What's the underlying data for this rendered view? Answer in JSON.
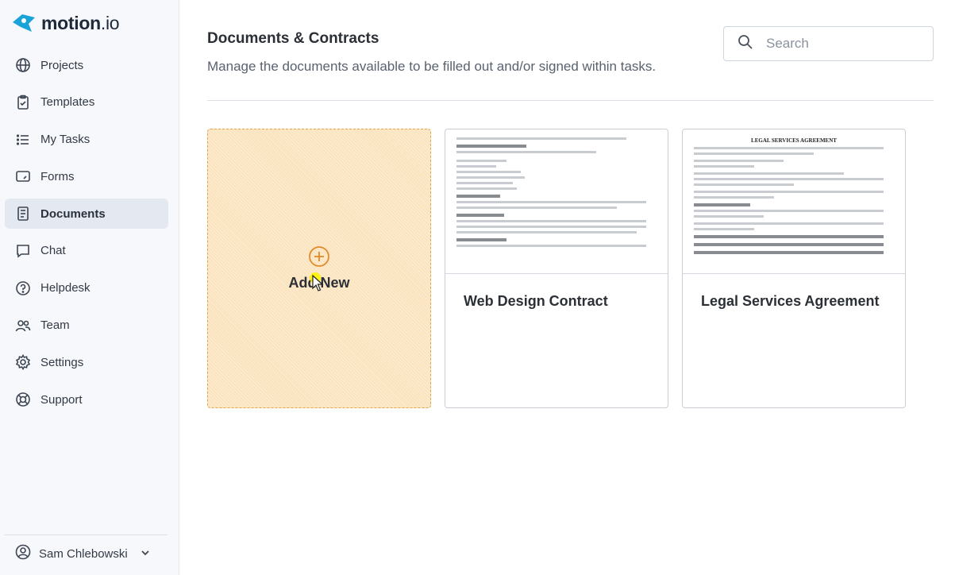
{
  "brand": {
    "name": "motion",
    "suffix": ".io"
  },
  "sidebar": {
    "items": [
      {
        "label": "Projects",
        "icon": "globe-icon",
        "active": false
      },
      {
        "label": "Templates",
        "icon": "clipboard-icon",
        "active": false
      },
      {
        "label": "My Tasks",
        "icon": "list-icon",
        "active": false
      },
      {
        "label": "Forms",
        "icon": "form-icon",
        "active": false
      },
      {
        "label": "Documents",
        "icon": "document-icon",
        "active": true
      },
      {
        "label": "Chat",
        "icon": "chat-icon",
        "active": false
      },
      {
        "label": "Helpdesk",
        "icon": "help-icon",
        "active": false
      },
      {
        "label": "Team",
        "icon": "team-icon",
        "active": false
      },
      {
        "label": "Settings",
        "icon": "gear-icon",
        "active": false
      },
      {
        "label": "Support",
        "icon": "lifebuoy-icon",
        "active": false
      }
    ],
    "user": {
      "name": "Sam Chlebowski"
    }
  },
  "header": {
    "title": "Documents & Contracts",
    "subtitle": "Manage the documents available to be filled out and/or signed within tasks."
  },
  "search": {
    "placeholder": "Search",
    "value": ""
  },
  "cards": {
    "add_new": {
      "label": "Add New"
    },
    "documents": [
      {
        "title": "Web Design Contract"
      },
      {
        "title": "Legal Services Agreement",
        "preview_heading": "LEGAL SERVICES AGREEMENT"
      }
    ]
  },
  "colors": {
    "add_card_bg": "#fbe3bd",
    "add_card_border": "#e0a64b",
    "active_nav_bg": "#e4e9f1",
    "logo": "#1aa3d9"
  }
}
